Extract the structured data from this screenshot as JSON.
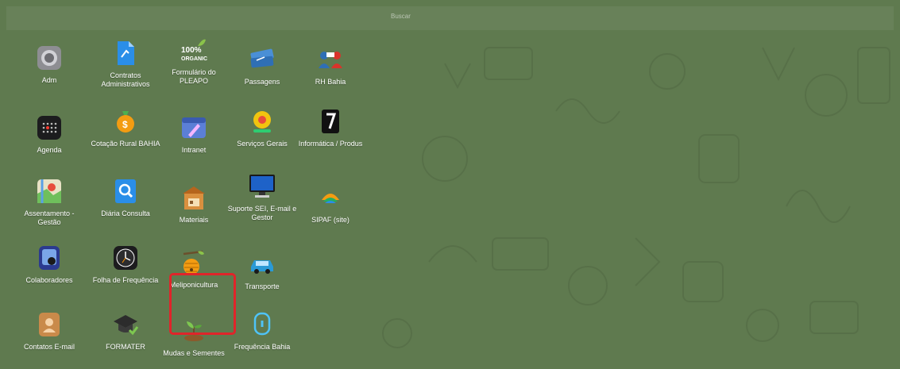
{
  "search": {
    "placeholder": "Buscar"
  },
  "apps": [
    {
      "label": "Adm",
      "icon": "gear-icon"
    },
    {
      "label": "Contratos Administrativos",
      "icon": "document-icon"
    },
    {
      "label": "Formulário do PLEAPO",
      "icon": "organic-icon"
    },
    {
      "label": "Passagens",
      "icon": "ticket-icon"
    },
    {
      "label": "RH Bahia",
      "icon": "people-icon"
    },
    {
      "label": "Agenda",
      "icon": "calendar-icon"
    },
    {
      "label": "Cotação Rural BAHIA",
      "icon": "money-bag-icon"
    },
    {
      "label": "Intranet",
      "icon": "browser-icon"
    },
    {
      "label": "Serviços Gerais",
      "icon": "cog-person-icon"
    },
    {
      "label": "Informática / Produs",
      "icon": "logo-icon"
    },
    {
      "label": "Assentamento - Gestão",
      "icon": "map-icon"
    },
    {
      "label": "Diária Consulta",
      "icon": "search-doc-icon"
    },
    {
      "label": "Materiais",
      "icon": "store-icon"
    },
    {
      "label": "Suporte SEI, E-mail e Gestor",
      "icon": "monitor-icon"
    },
    {
      "label": "SIPAF (site)",
      "icon": "sipaf-logo-icon"
    },
    {
      "label": "Colaboradores",
      "icon": "contacts-icon"
    },
    {
      "label": "Folha de Frequência",
      "icon": "clock-icon"
    },
    {
      "label": "Meliponicultura",
      "icon": "beehive-icon"
    },
    {
      "label": "Transporte",
      "icon": "car-icon"
    },
    {
      "label": "Contatos E-mail",
      "icon": "contact-card-icon"
    },
    {
      "label": "FORMATER",
      "icon": "graduation-cap-icon"
    },
    {
      "label": "Mudas e Sementes",
      "icon": "seedling-icon"
    },
    {
      "label": "Frequência Bahia",
      "icon": "touch-icon"
    }
  ],
  "colors": {
    "background": "#5f7a4f",
    "highlight": "#e0242a"
  }
}
